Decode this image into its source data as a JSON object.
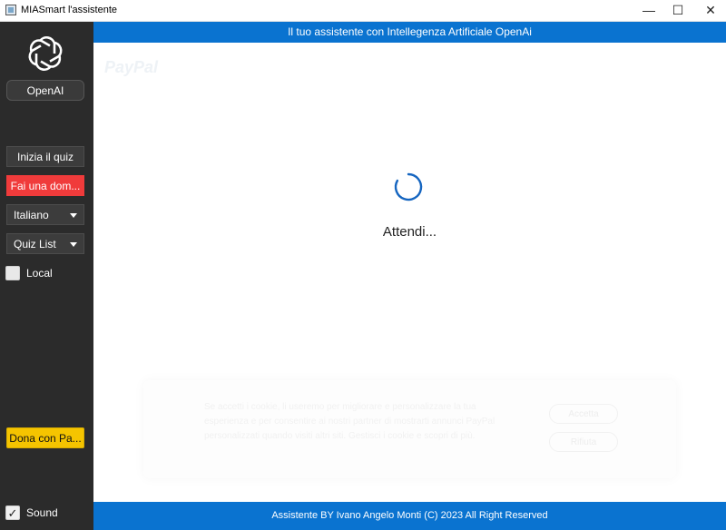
{
  "window": {
    "title": "MIASmart l'assistente",
    "controls": {
      "minimize": "—",
      "maximize": "☐",
      "close": "✕"
    }
  },
  "sidebar": {
    "openai_label": "OpenAI",
    "quiz_button": "Inizia il quiz",
    "ask_button": "Fai una dom...",
    "language_select": "Italiano",
    "quiz_select": "Quiz List",
    "local_label": "Local",
    "local_checked": false,
    "donate_button": "Dona con Pa...",
    "sound_label": "Sound",
    "sound_checked": true,
    "colors": {
      "background": "#2b2b2b",
      "ask": "#f03b3b",
      "donate": "#f5c400"
    }
  },
  "header": {
    "text": "Il tuo assistente con Intellegenza Artificiale OpenAi"
  },
  "content": {
    "paypal_logo": "PayPal",
    "loading_text": "Attendi...",
    "cookie_text": "Se accetti i cookie, li useremo per migliorare e personalizzare la tua esperienza e per consentire ai nostri partner di mostrarti annunci PayPal personalizzati quando visiti altri siti. Gestisci i cookie e scopri di più.",
    "cookie_accept": "Accetta",
    "cookie_refuse": "Rifiuta"
  },
  "footer": {
    "text": "Assistente BY Ivano Angelo Monti (C) 2023 All Right Reserved"
  },
  "colors": {
    "accent": "#0a73d0",
    "spinner": "#1565c0"
  }
}
